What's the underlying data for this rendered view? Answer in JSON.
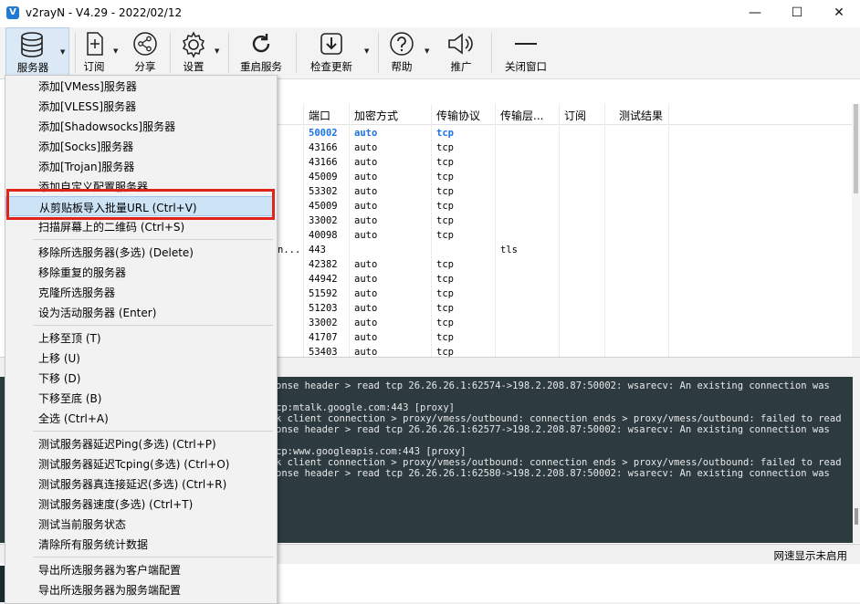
{
  "window": {
    "title": "v2rayN - V4.29 - 2022/02/12",
    "minimize": "—",
    "maximize": "☐",
    "close": "✕"
  },
  "toolbar": {
    "servers": "服务器",
    "subscription": "订阅",
    "share": "分享",
    "settings": "设置",
    "reload": "重启服务",
    "check_update": "检查更新",
    "help": "帮助",
    "promotion": "推广",
    "close_window": "关闭窗口"
  },
  "menu": {
    "items": [
      "添加[VMess]服务器",
      "添加[VLESS]服务器",
      "添加[Shadowsocks]服务器",
      "添加[Socks]服务器",
      "添加[Trojan]服务器",
      "添加自定义配置服务器",
      "从剪贴板导入批量URL (Ctrl+V)",
      "扫描屏幕上的二维码 (Ctrl+S)",
      "移除所选服务器(多选) (Delete)",
      "移除重复的服务器",
      "克隆所选服务器",
      "设为活动服务器 (Enter)",
      "上移至顶 (T)",
      "上移 (U)",
      "下移 (D)",
      "下移至底 (B)",
      "全选 (Ctrl+A)",
      "测试服务器延迟Ping(多选) (Ctrl+P)",
      "测试服务器延迟Tcping(多选) (Ctrl+O)",
      "测试服务器真连接延迟(多选) (Ctrl+R)",
      "测试服务器速度(多选) (Ctrl+T)",
      "测试当前服务状态",
      "清除所有服务统计数据",
      "导出所选服务器为客户端配置",
      "导出所选服务器为服务端配置"
    ]
  },
  "grid": {
    "headers": [
      "端口",
      "加密方式",
      "传输协议",
      "传输层...",
      "订阅",
      "测试结果"
    ],
    "rows": [
      [
        "50002",
        "auto",
        "tcp",
        ""
      ],
      [
        "43166",
        "auto",
        "tcp",
        ""
      ],
      [
        "43166",
        "auto",
        "tcp",
        ""
      ],
      [
        "45009",
        "auto",
        "tcp",
        ""
      ],
      [
        "53302",
        "auto",
        "tcp",
        ""
      ],
      [
        "45009",
        "auto",
        "tcp",
        ""
      ],
      [
        "33002",
        "auto",
        "tcp",
        ""
      ],
      [
        "40098",
        "auto",
        "tcp",
        ""
      ],
      [
        "443",
        "",
        "",
        "tls"
      ],
      [
        "42382",
        "auto",
        "tcp",
        ""
      ],
      [
        "44942",
        "auto",
        "tcp",
        ""
      ],
      [
        "51592",
        "auto",
        "tcp",
        ""
      ],
      [
        "51203",
        "auto",
        "tcp",
        ""
      ],
      [
        "33002",
        "auto",
        "tcp",
        ""
      ],
      [
        "41707",
        "auto",
        "tcp",
        ""
      ],
      [
        "53403",
        "auto",
        "tcp",
        ""
      ]
    ],
    "truncated_cell": "n..."
  },
  "console": {
    "lines": [
      "onse header > read tcp 26.26.26.1:62574->198.2.208.87:50002: wsarecv: An existing connection was",
      "",
      "cp:mtalk.google.com:443 [proxy]",
      "k client connection > proxy/vmess/outbound: connection ends > proxy/vmess/outbound: failed to read",
      "onse header > read tcp 26.26.26.1:62577->198.2.208.87:50002: wsarecv: An existing connection was",
      "",
      "cp:www.googleapis.com:443 [proxy]",
      "k client connection > proxy/vmess/outbound: connection ends > proxy/vmess/outbound: failed to read",
      "onse header > read tcp 26.26.26.1:62580->198.2.208.87:50002: wsarecv: An existing connection was"
    ]
  },
  "status": {
    "right_text": "网速显示未启用"
  },
  "colors": {
    "highlight_box": "#e0241c",
    "selected_item": "#cde4f7",
    "console_bg": "#2d3b40",
    "first_row": "#1a73e8"
  }
}
